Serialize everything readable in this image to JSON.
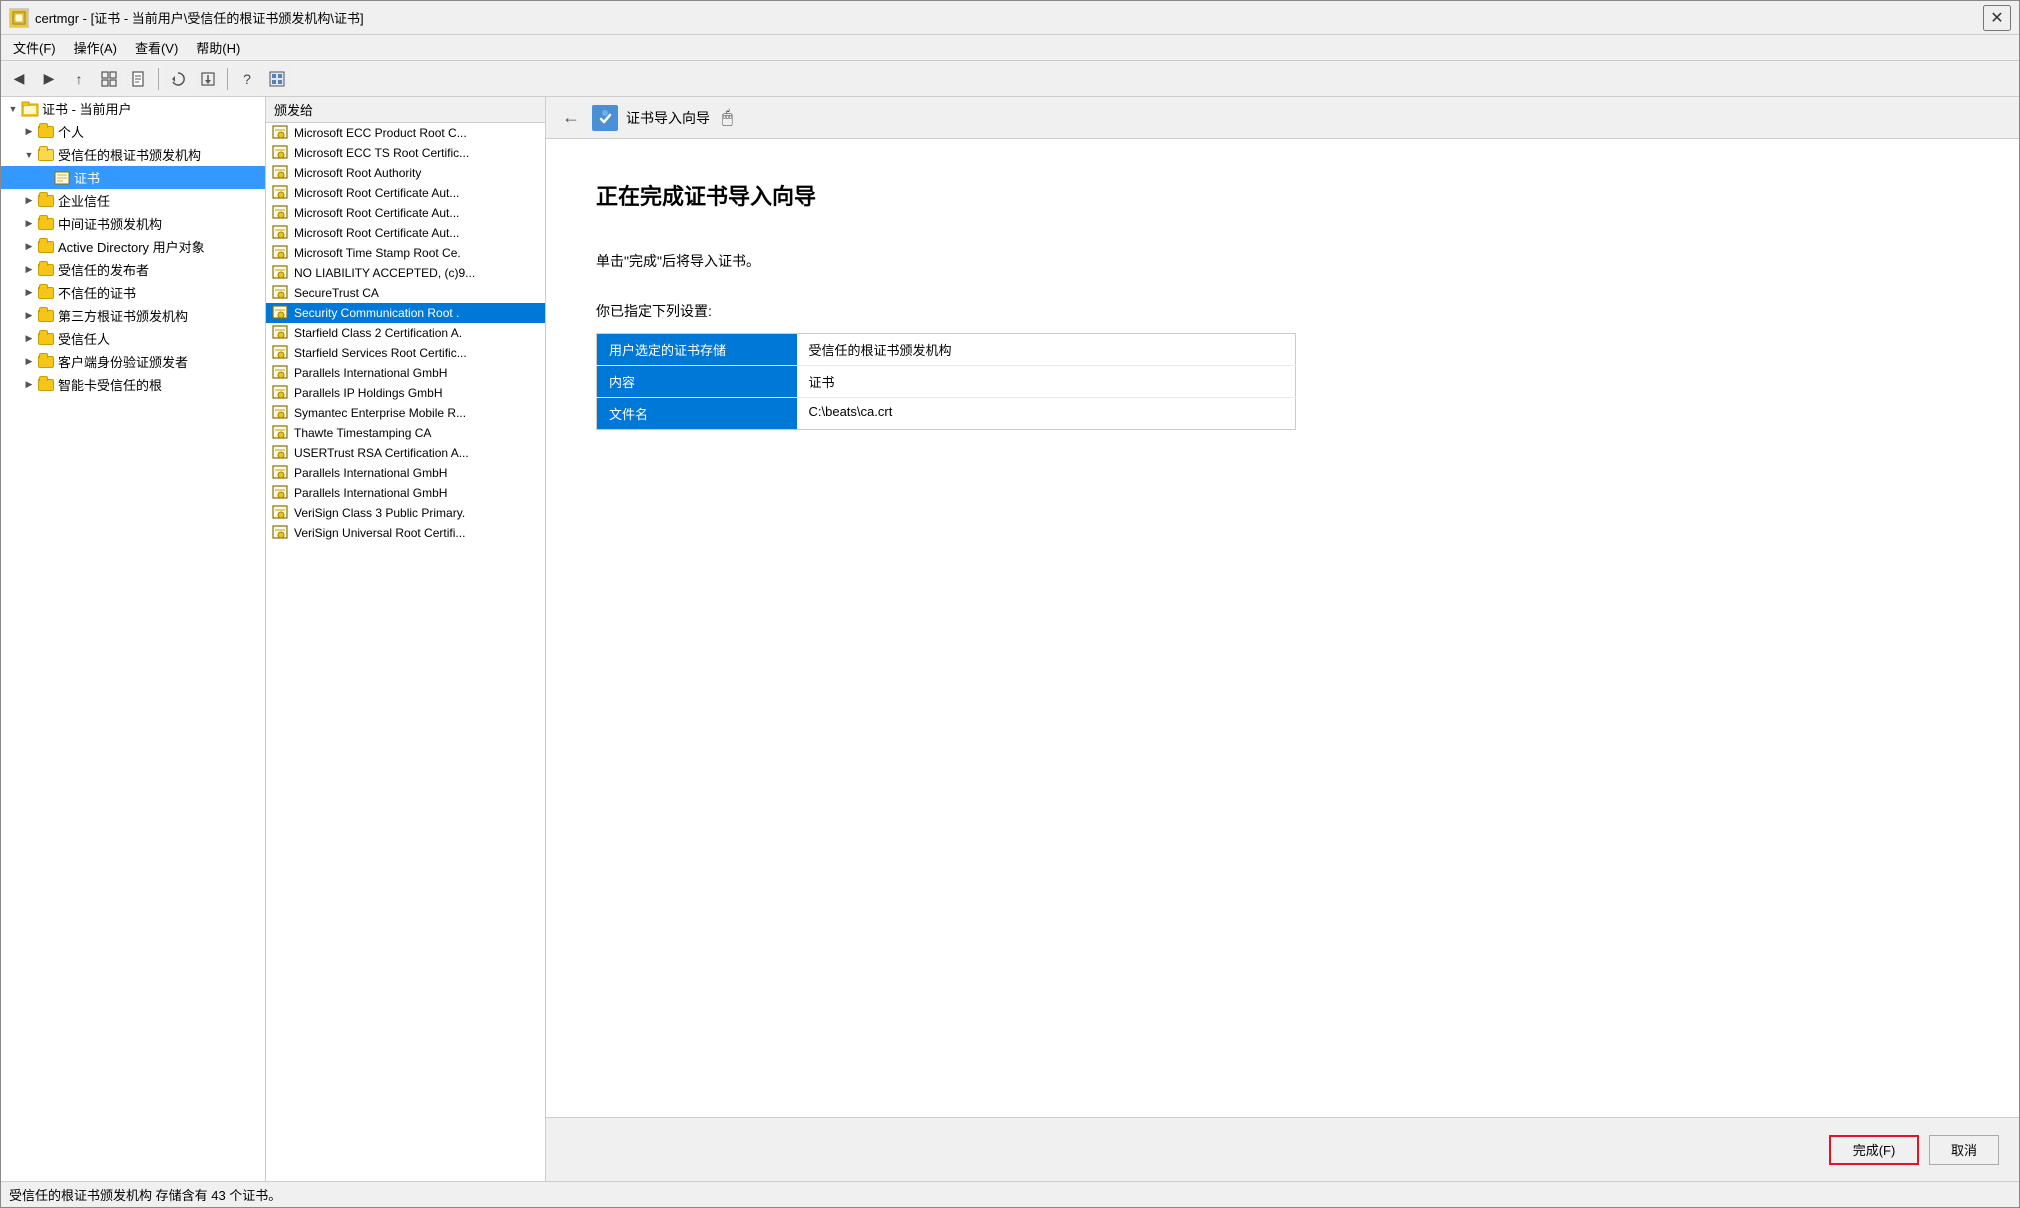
{
  "window": {
    "title": "certmgr - [证书 - 当前用户\\受信任的根证书颁发机构\\证书]",
    "close_label": "✕"
  },
  "menubar": {
    "items": [
      {
        "label": "文件(F)"
      },
      {
        "label": "操作(A)"
      },
      {
        "label": "查看(V)"
      },
      {
        "label": "帮助(H)"
      }
    ]
  },
  "toolbar": {
    "buttons": [
      {
        "icon": "◀",
        "name": "back-btn"
      },
      {
        "icon": "▶",
        "name": "forward-btn"
      },
      {
        "icon": "↑",
        "name": "up-btn"
      },
      {
        "icon": "▦",
        "name": "view-btn"
      },
      {
        "icon": "📄",
        "name": "doc-btn"
      },
      {
        "icon": "⟳",
        "name": "refresh-btn"
      },
      {
        "icon": "⊡",
        "name": "export-btn"
      },
      {
        "icon": "?",
        "name": "help-btn"
      },
      {
        "icon": "▦",
        "name": "mmc-btn"
      }
    ]
  },
  "tree": {
    "root_label": "证书 - 当前用户",
    "items": [
      {
        "label": "个人",
        "indent": 1,
        "expanded": false
      },
      {
        "label": "受信任的根证书颁发机构",
        "indent": 1,
        "expanded": true,
        "selected": false
      },
      {
        "label": "证书",
        "indent": 2,
        "selected": true,
        "is_cert_store": true
      },
      {
        "label": "企业信任",
        "indent": 1,
        "expanded": false
      },
      {
        "label": "中间证书颁发机构",
        "indent": 1,
        "expanded": false
      },
      {
        "label": "Active Directory 用户对象",
        "indent": 1,
        "expanded": false
      },
      {
        "label": "受信任的发布者",
        "indent": 1,
        "expanded": false
      },
      {
        "label": "不信任的证书",
        "indent": 1,
        "expanded": false
      },
      {
        "label": "第三方根证书颁发机构",
        "indent": 1,
        "expanded": false
      },
      {
        "label": "受信任人",
        "indent": 1,
        "expanded": false
      },
      {
        "label": "客户端身份验证颁发者",
        "indent": 1,
        "expanded": false
      },
      {
        "label": "智能卡受信任的根",
        "indent": 1,
        "expanded": false
      }
    ]
  },
  "cert_list": {
    "header": "颁发给",
    "items": [
      {
        "label": "Microsoft ECC Product Root C..."
      },
      {
        "label": "Microsoft ECC TS Root Certific..."
      },
      {
        "label": "Microsoft Root Authority"
      },
      {
        "label": "Microsoft Root Certificate Aut..."
      },
      {
        "label": "Microsoft Root Certificate Aut..."
      },
      {
        "label": "Microsoft Root Certificate Aut..."
      },
      {
        "label": "Microsoft Time Stamp Root Ce."
      },
      {
        "label": "NO LIABILITY ACCEPTED, (c)9..."
      },
      {
        "label": "SecureTrust CA"
      },
      {
        "label": "Security Communication Root .",
        "selected": true
      },
      {
        "label": "Starfield Class 2 Certification A."
      },
      {
        "label": "Starfield Services Root Certific..."
      },
      {
        "label": "Parallels International GmbH"
      },
      {
        "label": "Parallels IP Holdings GmbH"
      },
      {
        "label": "Symantec Enterprise Mobile R..."
      },
      {
        "label": "Thawte Timestamping CA"
      },
      {
        "label": "USERTrust RSA Certification A..."
      },
      {
        "label": "Parallels International GmbH"
      },
      {
        "label": "Parallels International GmbH"
      },
      {
        "label": "VeriSign Class 3 Public Primary."
      },
      {
        "label": "VeriSign Universal Root Certifi..."
      }
    ]
  },
  "wizard": {
    "back_icon": "←",
    "icon": "🔐",
    "title": "证书导入向导",
    "main_title": "正在完成证书导入向导",
    "description": "单击\"完成\"后将导入证书。",
    "settings_label": "你已指定下列设置:",
    "table_rows": [
      {
        "key": "用户选定的证书存储",
        "value": "受信任的根证书颁发机构"
      },
      {
        "key": "内容",
        "value": "证书"
      },
      {
        "key": "文件名",
        "value": "C:\\beats\\ca.crt"
      }
    ],
    "finish_label": "完成(F)",
    "cancel_label": "取消"
  },
  "status_bar": {
    "text": "受信任的根证书颁发机构 存储含有 43 个证书。"
  }
}
